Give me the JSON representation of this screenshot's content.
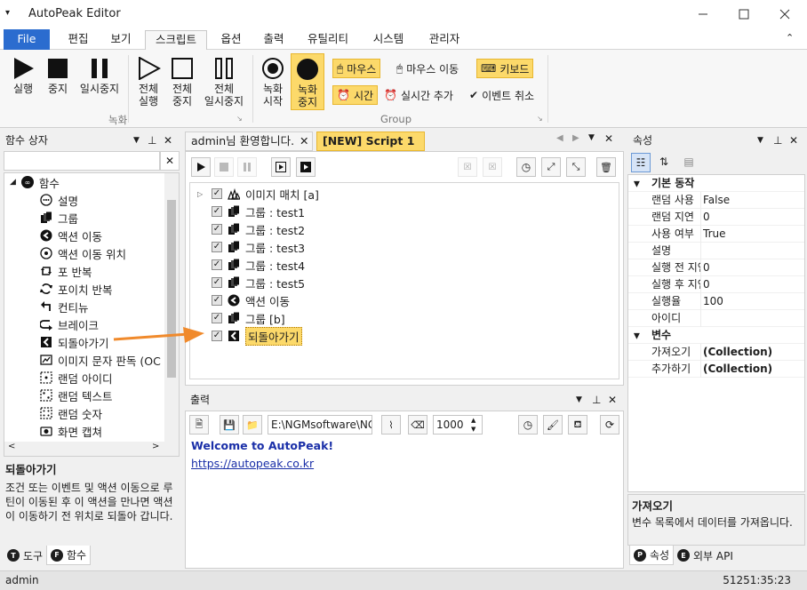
{
  "window": {
    "title": "AutoPeak Editor"
  },
  "ribbon_tabs": [
    {
      "label": "File"
    },
    {
      "label": "편집"
    },
    {
      "label": "보기"
    },
    {
      "label": "스크립트"
    },
    {
      "label": "옵션"
    },
    {
      "label": "출력"
    },
    {
      "label": "유틸리티"
    },
    {
      "label": "시스템"
    },
    {
      "label": "관리자"
    }
  ],
  "ribbon": {
    "run": "실행",
    "stop": "중지",
    "pause": "일시중지",
    "run_all": [
      "전체",
      "실행"
    ],
    "stop_all": [
      "전체",
      "중지"
    ],
    "pause_all": [
      "전체",
      "일시중지"
    ],
    "rec_start": [
      "녹화",
      "시작"
    ],
    "rec_stop": [
      "녹화",
      "중지"
    ],
    "mouse": "마우스",
    "mouse_move": "마우스 이동",
    "keyboard": "키보드",
    "time": "시간",
    "realtime_add": "실시간 추가",
    "event_cancel": "이벤트 취소",
    "group_record": "녹화",
    "group_group": "Group"
  },
  "functions_panel": {
    "title": "함수 상자",
    "root": "함수",
    "items": [
      {
        "label": "설명",
        "icon": "comment-icon"
      },
      {
        "label": "그룹",
        "icon": "group-icon"
      },
      {
        "label": "액션 이동",
        "icon": "action-move-icon"
      },
      {
        "label": "액션 이동 위치",
        "icon": "action-target-icon"
      },
      {
        "label": "포 반복",
        "icon": "for-loop-icon"
      },
      {
        "label": "포이치 반복",
        "icon": "foreach-loop-icon"
      },
      {
        "label": "컨티뉴",
        "icon": "continue-icon"
      },
      {
        "label": "브레이크",
        "icon": "break-icon"
      },
      {
        "label": "되돌아가기",
        "icon": "return-icon"
      },
      {
        "label": "이미지 문자 판독 (OC",
        "icon": "ocr-icon"
      },
      {
        "label": "랜덤 아이디",
        "icon": "random-id-icon"
      },
      {
        "label": "랜덤 텍스트",
        "icon": "random-text-icon"
      },
      {
        "label": "랜덤 숫자",
        "icon": "random-number-icon"
      },
      {
        "label": "화면 캡쳐",
        "icon": "screen-capture-icon"
      }
    ],
    "desc_title": "되돌아가기",
    "desc_text": "조건 또는 이벤트 및 액션 이동으로 루틴이 이동된 후 이 액션을 만나면 액션이 이동하기 전 위치로 되돌아 갑니다.",
    "tabs": [
      {
        "letter": "T",
        "label": "도구"
      },
      {
        "letter": "F",
        "label": "함수"
      }
    ]
  },
  "editor": {
    "tabs": [
      {
        "label": "admin님 환영합니다."
      },
      {
        "label": "[NEW] Script 1"
      }
    ],
    "tree": [
      {
        "label": "이미지 매치 [a]",
        "icon": "image-match-icon"
      },
      {
        "label": "그룹 : test1",
        "icon": "group-icon"
      },
      {
        "label": "그룹 : test2",
        "icon": "group-icon"
      },
      {
        "label": "그룹 : test3",
        "icon": "group-icon"
      },
      {
        "label": "그룹 : test4",
        "icon": "group-icon"
      },
      {
        "label": "그룹 : test5",
        "icon": "group-icon"
      },
      {
        "label": "액션 이동",
        "icon": "action-move-icon"
      },
      {
        "label": "그룹 [b]",
        "icon": "group-icon"
      },
      {
        "label": "되돌아가기",
        "icon": "return-icon"
      }
    ]
  },
  "output": {
    "title": "출력",
    "path": "E:\\NGMsoftware\\NG",
    "count": "1000",
    "lines": [
      "Welcome to AutoPeak!",
      "https://autopeak.co.kr"
    ]
  },
  "properties": {
    "title": "속성",
    "categories": [
      {
        "name": "기본 동작",
        "rows": [
          {
            "key": "랜덤 사용",
            "value": "False"
          },
          {
            "key": "랜덤 지연",
            "value": "0"
          },
          {
            "key": "사용 여부",
            "value": "True"
          },
          {
            "key": "설명",
            "value": ""
          },
          {
            "key": "실행 전 지연",
            "value": "0"
          },
          {
            "key": "실행 후 지연",
            "value": "0"
          },
          {
            "key": "실행율",
            "value": "100"
          },
          {
            "key": "아이디",
            "value": ""
          }
        ]
      },
      {
        "name": "변수",
        "rows": [
          {
            "key": "가져오기",
            "value": "(Collection)"
          },
          {
            "key": "추가하기",
            "value": "(Collection)"
          }
        ]
      }
    ],
    "desc_title": "가져오기",
    "desc_text": "변수 목록에서 데이터를 가져옵니다.",
    "tabs": [
      {
        "letter": "P",
        "label": "속성"
      },
      {
        "letter": "E",
        "label": "외부 API"
      }
    ]
  },
  "status": {
    "user": "admin",
    "time": "51251:35:23"
  },
  "colors": {
    "accent": "#2b6ccf",
    "highlight": "#fcd96a",
    "arrow": "#f08a2c"
  }
}
